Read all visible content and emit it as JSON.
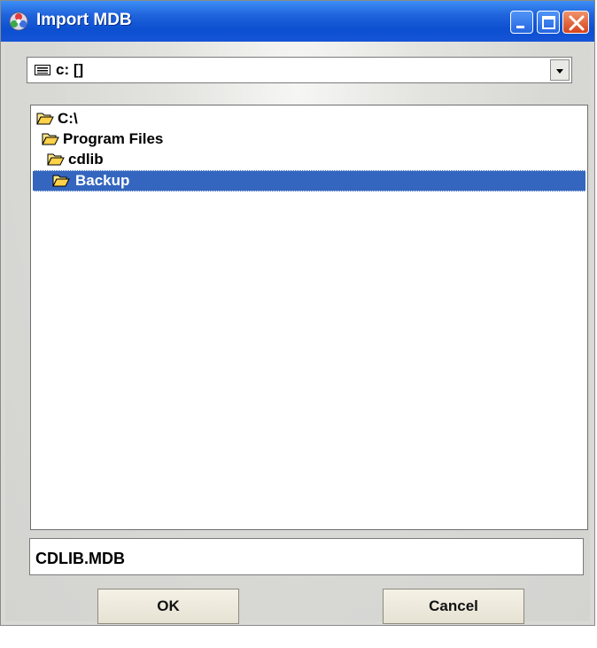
{
  "window": {
    "title": "Import MDB"
  },
  "drive_selector": {
    "value": "c: []"
  },
  "folders": [
    {
      "label": "C:\\",
      "selected": false
    },
    {
      "label": "Program Files",
      "selected": false
    },
    {
      "label": "cdlib",
      "selected": false
    },
    {
      "label": "Backup",
      "selected": true
    }
  ],
  "file_name": {
    "value": "CDLIB.MDB"
  },
  "buttons": {
    "ok_label": "OK",
    "cancel_label": "Cancel"
  },
  "colors": {
    "titlebar": "#0c4fd0",
    "selection": "#3466bf",
    "close_button": "#d6431c"
  }
}
